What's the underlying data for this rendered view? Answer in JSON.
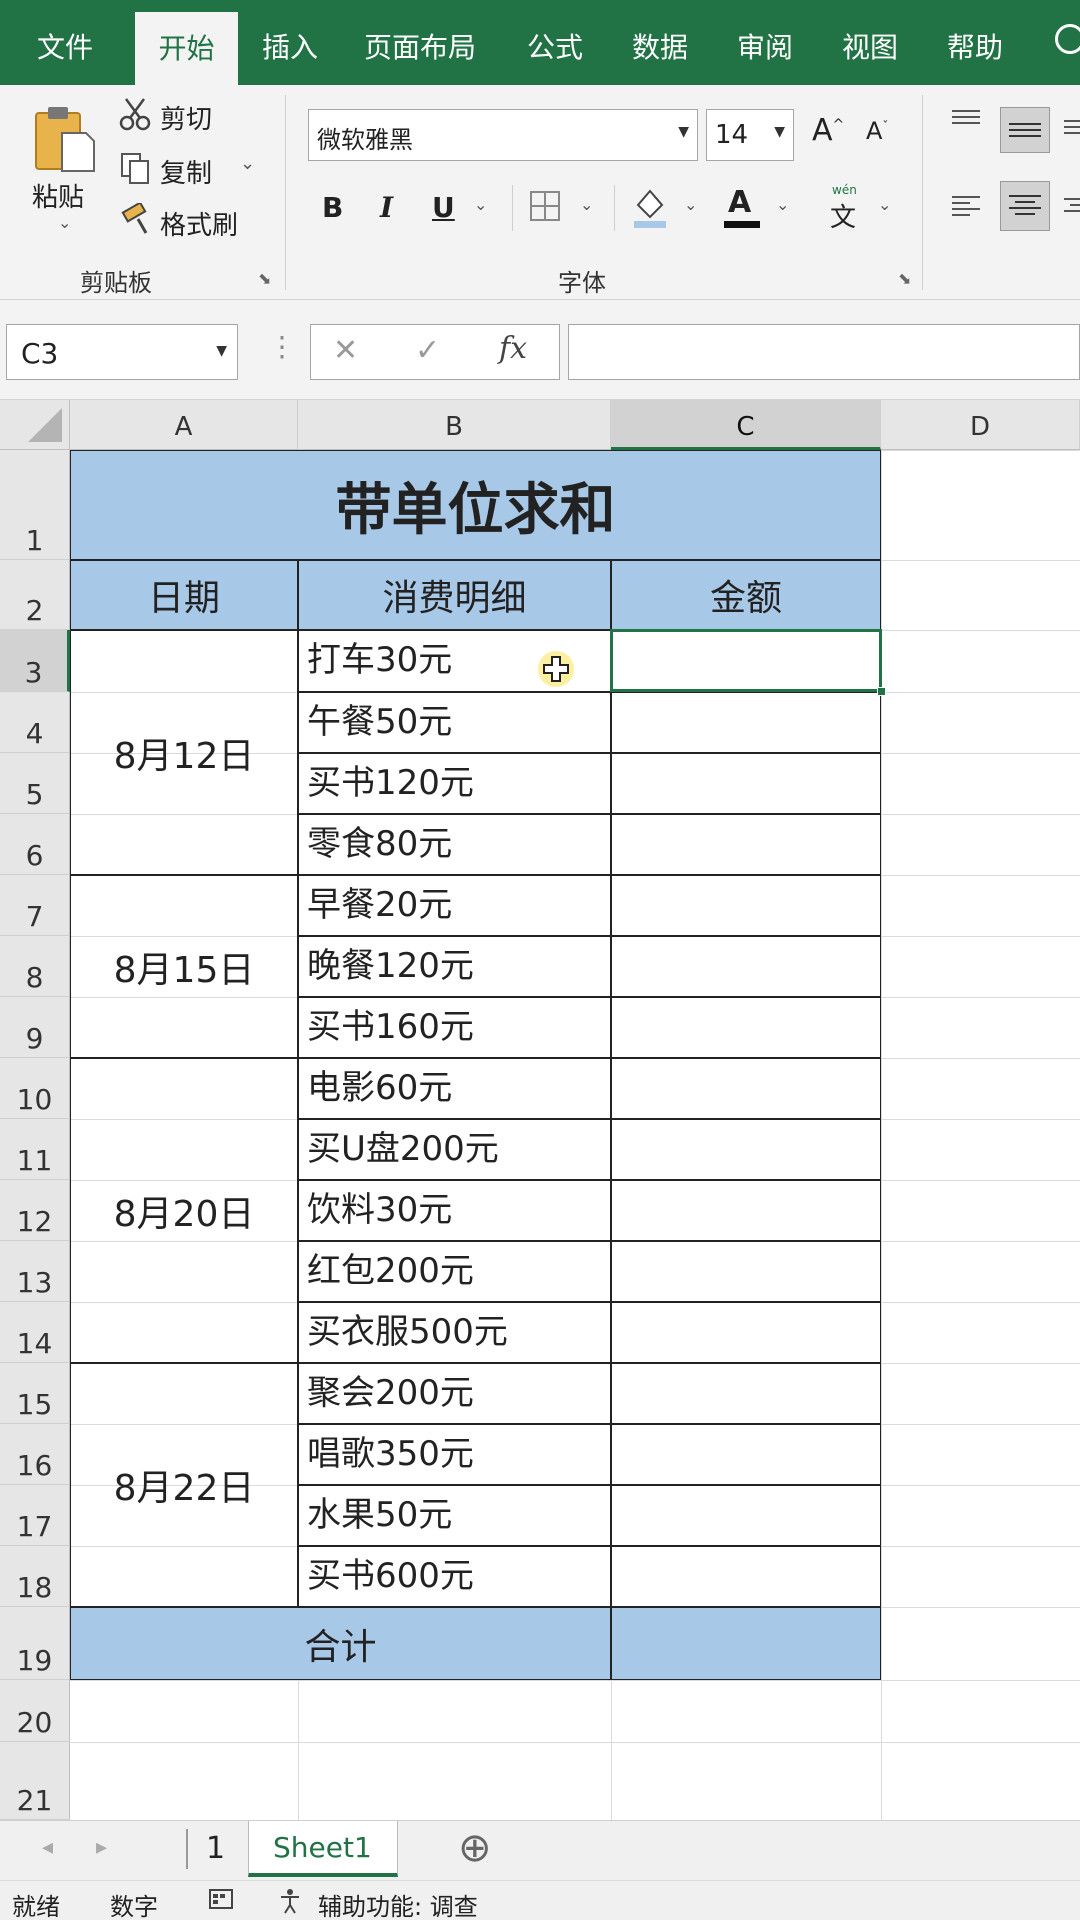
{
  "menu": {
    "tabs": [
      "文件",
      "开始",
      "插入",
      "页面布局",
      "公式",
      "数据",
      "审阅",
      "视图",
      "帮助"
    ],
    "active": "开始"
  },
  "ribbon": {
    "clipboard": {
      "paste": "粘贴",
      "cut": "剪切",
      "copy": "复制",
      "format_painter": "格式刷",
      "group_label": "剪贴板"
    },
    "font": {
      "font_name": "微软雅黑",
      "font_size": "14",
      "group_label": "字体",
      "bold": "B",
      "italic": "I",
      "underline": "U",
      "font_color_glyph": "A",
      "phonetic_glyph": "文",
      "phonetic_small": "wén",
      "grow": "A",
      "shrink": "A"
    }
  },
  "formula_bar": {
    "name_box": "C3",
    "cancel": "✕",
    "enter": "✓",
    "fx": "fx",
    "formula": ""
  },
  "sheet": {
    "columns": [
      "A",
      "B",
      "C",
      "D"
    ],
    "rows": [
      "1",
      "2",
      "3",
      "4",
      "5",
      "6",
      "7",
      "8",
      "9",
      "10",
      "11",
      "12",
      "13",
      "14",
      "15",
      "16",
      "17",
      "18",
      "19",
      "20",
      "21"
    ],
    "selected_cell": "C3",
    "title": "带单位求和",
    "headers": {
      "date": "日期",
      "detail": "消费明细",
      "amount": "金额"
    },
    "groups": [
      {
        "date": "8月12日",
        "items": [
          "打车30元",
          "午餐50元",
          "买书120元",
          "零食80元"
        ]
      },
      {
        "date": "8月15日",
        "items": [
          "早餐20元",
          "晚餐120元",
          "买书160元"
        ]
      },
      {
        "date": "8月20日",
        "items": [
          "电影60元",
          "买U盘200元",
          "饮料30元",
          "红包200元",
          "买衣服500元"
        ]
      },
      {
        "date": "8月22日",
        "items": [
          "聚会200元",
          "唱歌350元",
          "水果50元",
          "买书600元"
        ]
      }
    ],
    "total_label": "合计",
    "header_fill": "#a8c8e8",
    "accent": "#217346"
  },
  "sheet_tabs": {
    "prev": "◂",
    "next": "▸",
    "tab_num": "1",
    "active": "Sheet1",
    "add": "⊕"
  },
  "status": {
    "ready": "就绪",
    "mode": "数字",
    "accessibility": "辅助功能: 调查"
  }
}
